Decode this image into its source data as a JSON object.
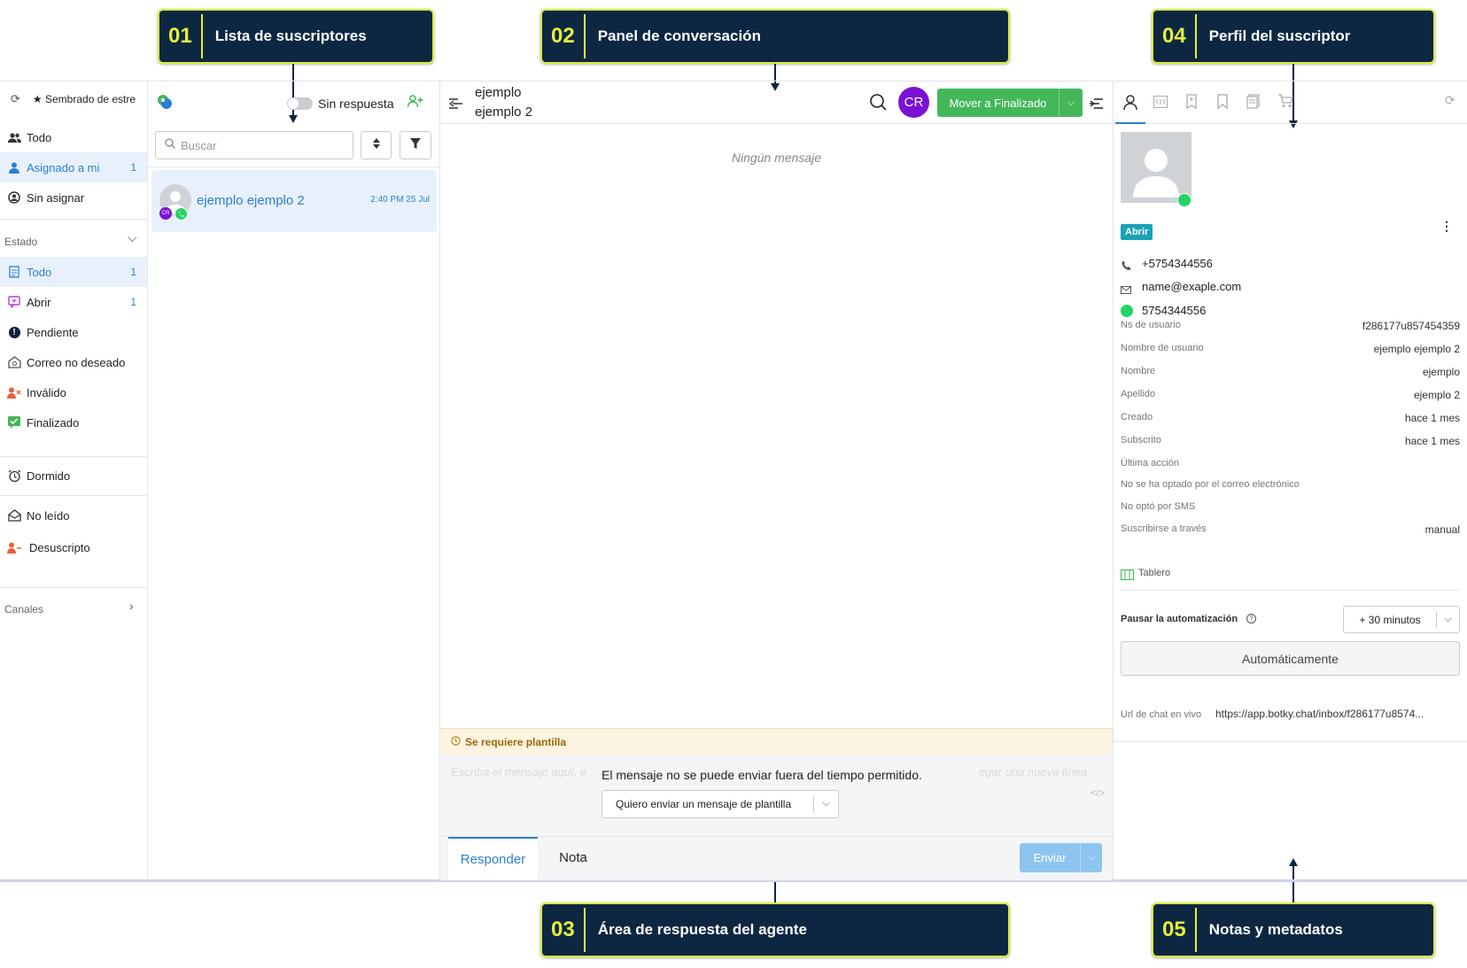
{
  "callouts": [
    {
      "num": "01",
      "label": "Lista de suscriptores"
    },
    {
      "num": "02",
      "label": "Panel de conversación"
    },
    {
      "num": "04",
      "label": "Perfil del suscriptor"
    },
    {
      "num": "03",
      "label": "Área de respuesta del agente"
    },
    {
      "num": "05",
      "label": "Notas y metadatos"
    }
  ],
  "sidebar": {
    "top_label": "★ Sembrado de estre",
    "items": [
      {
        "label": "Todo",
        "count": ""
      },
      {
        "label": "Asignado a mi",
        "count": "1"
      },
      {
        "label": "Sin asignar",
        "count": ""
      }
    ],
    "estado_label": "Estado",
    "estado_items": [
      {
        "label": "Todo",
        "count": "1"
      },
      {
        "label": "Abrir",
        "count": "1"
      },
      {
        "label": "Pendiente",
        "count": ""
      },
      {
        "label": "Correo no deseado",
        "count": ""
      },
      {
        "label": "Inválido",
        "count": ""
      },
      {
        "label": "Finalizado",
        "count": ""
      }
    ],
    "dormido": "Dormido",
    "no_leido": "No leído",
    "desuscripto": "Desuscripto",
    "canales": "Canales"
  },
  "list": {
    "toggle_label": "Sin respuesta",
    "search_placeholder": "Buscar",
    "item": {
      "name": "ejemplo ejemplo 2",
      "time": "2:40 PM 25 Jul",
      "badge": "CR"
    }
  },
  "conversation": {
    "name_line1": "ejemplo",
    "name_line2": "ejemplo 2",
    "avatar": "CR",
    "move_button": "Mover a Finalizado",
    "no_messages": "Ningún mensaje",
    "template_required": "Se requiere plantilla",
    "placeholder_left": "Escriba el mensaje aquí, e",
    "placeholder_right": "egar una nueva línea",
    "outside_window": "El mensaje no se puede enviar fuera del tiempo permitido.",
    "template_select": "Quiero enviar un mensaje de plantilla",
    "tab_reply": "Responder",
    "tab_note": "Nota",
    "send_button": "Enviar"
  },
  "profile": {
    "status": "Abrir",
    "phone": "+5754344556",
    "email": "name@exaple.com",
    "whatsapp": "5754344556",
    "fields": [
      {
        "label": "Ns de usuario",
        "value": "f286177u857454359"
      },
      {
        "label": "Nombre de usuario",
        "value": "ejemplo ejemplo 2"
      },
      {
        "label": "Nombre",
        "value": "ejemplo"
      },
      {
        "label": "Apellido",
        "value": "ejemplo 2"
      },
      {
        "label": "Creado",
        "value": "hace 1 mes"
      },
      {
        "label": "Subscrito",
        "value": "hace 1 mes"
      },
      {
        "label": "Última acción",
        "value": ""
      },
      {
        "label": "No se ha optado por el correo electrónico",
        "value": ""
      },
      {
        "label": "No optó por SMS",
        "value": ""
      },
      {
        "label": "Suscribirse a través",
        "value": "manual"
      }
    ],
    "tablero": "Tablero",
    "pause_label": "Pausar la automatización",
    "pause_value": "+ 30 minutos",
    "auto_button": "Automáticamente",
    "url_label": "Url de chat en vivo",
    "url_value": "https://app.botky.chat/inbox/f286177u8574..."
  },
  "colors": {
    "accent": "#2b7fd3",
    "green": "#44b75a",
    "callout_bg": "#0d2742",
    "callout_border": "#d9ea3a"
  }
}
